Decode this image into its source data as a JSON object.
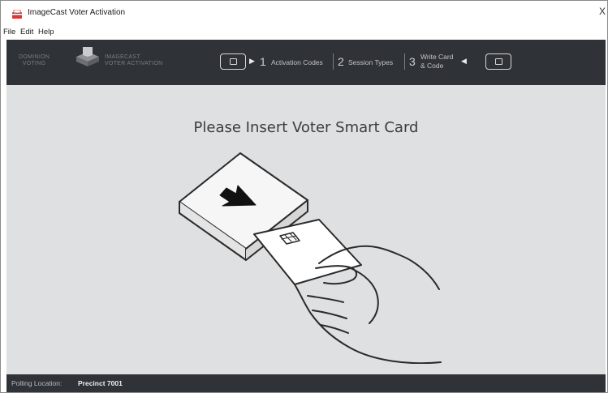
{
  "window": {
    "title": "ImageCast Voter Activation",
    "close_glyph": "X"
  },
  "menu": {
    "items": [
      "File",
      "Edit",
      "Help"
    ]
  },
  "header": {
    "logo_left_line1": "DOMINION",
    "logo_left_line2": "VOTING",
    "logo_right_line1": "IMAGECAST",
    "logo_right_line2": "VOTER ACTIVATION",
    "steps": [
      {
        "number": "1",
        "label": "Activation Codes"
      },
      {
        "number": "2",
        "label": "Session Types"
      },
      {
        "number": "3",
        "label_line1": "Write Card",
        "label_line2": "& Code"
      }
    ]
  },
  "main": {
    "prompt": "Please Insert Voter Smart Card"
  },
  "status": {
    "label": "Polling Location:",
    "value": "Precinct 7001"
  },
  "colors": {
    "header_bg": "#2f3236",
    "content_bg": "#dfe0e2",
    "status_bg": "#2f3236"
  },
  "icons": {
    "app": "ballot-box-icon",
    "card_slot": "card-slot-icon",
    "arrow": "insert-arrow-icon"
  }
}
